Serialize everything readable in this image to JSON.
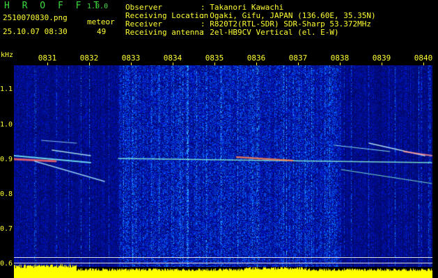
{
  "app": {
    "name": "H R O F F T",
    "version": "1.0.0",
    "filename": "2510070830.png",
    "timestamp": "25.10.07 08:30",
    "meteor_label": "meteor",
    "meteor_count": "49"
  },
  "info": {
    "labels": [
      "Observer",
      "Receiving Location",
      "Receiver",
      "Receiving antenna"
    ],
    "values": [
      ": Takanori Kawachi",
      ": Ogaki, Gifu, JAPAN (136.60E, 35.35N)",
      ": R820T2(RTL-SDR) SDR-Sharp 53.372MHz",
      ": 2el-HB9CV Vertical (el. E-W)"
    ]
  },
  "axis": {
    "unit": "kHz",
    "times": [
      "0831",
      "0832",
      "0833",
      "0834",
      "0835",
      "0836",
      "0837",
      "0838",
      "0839",
      "0840"
    ],
    "freqs": [
      "1.1",
      "1.0",
      "0.9",
      "0.8",
      "0.7",
      "0.6"
    ]
  },
  "colors": {
    "background": "#000000",
    "header_text": "#ffff33",
    "title_text": "#3ddc3d",
    "info_text": "#e8e8e8",
    "spectrum_fill": "#ffff00"
  }
}
